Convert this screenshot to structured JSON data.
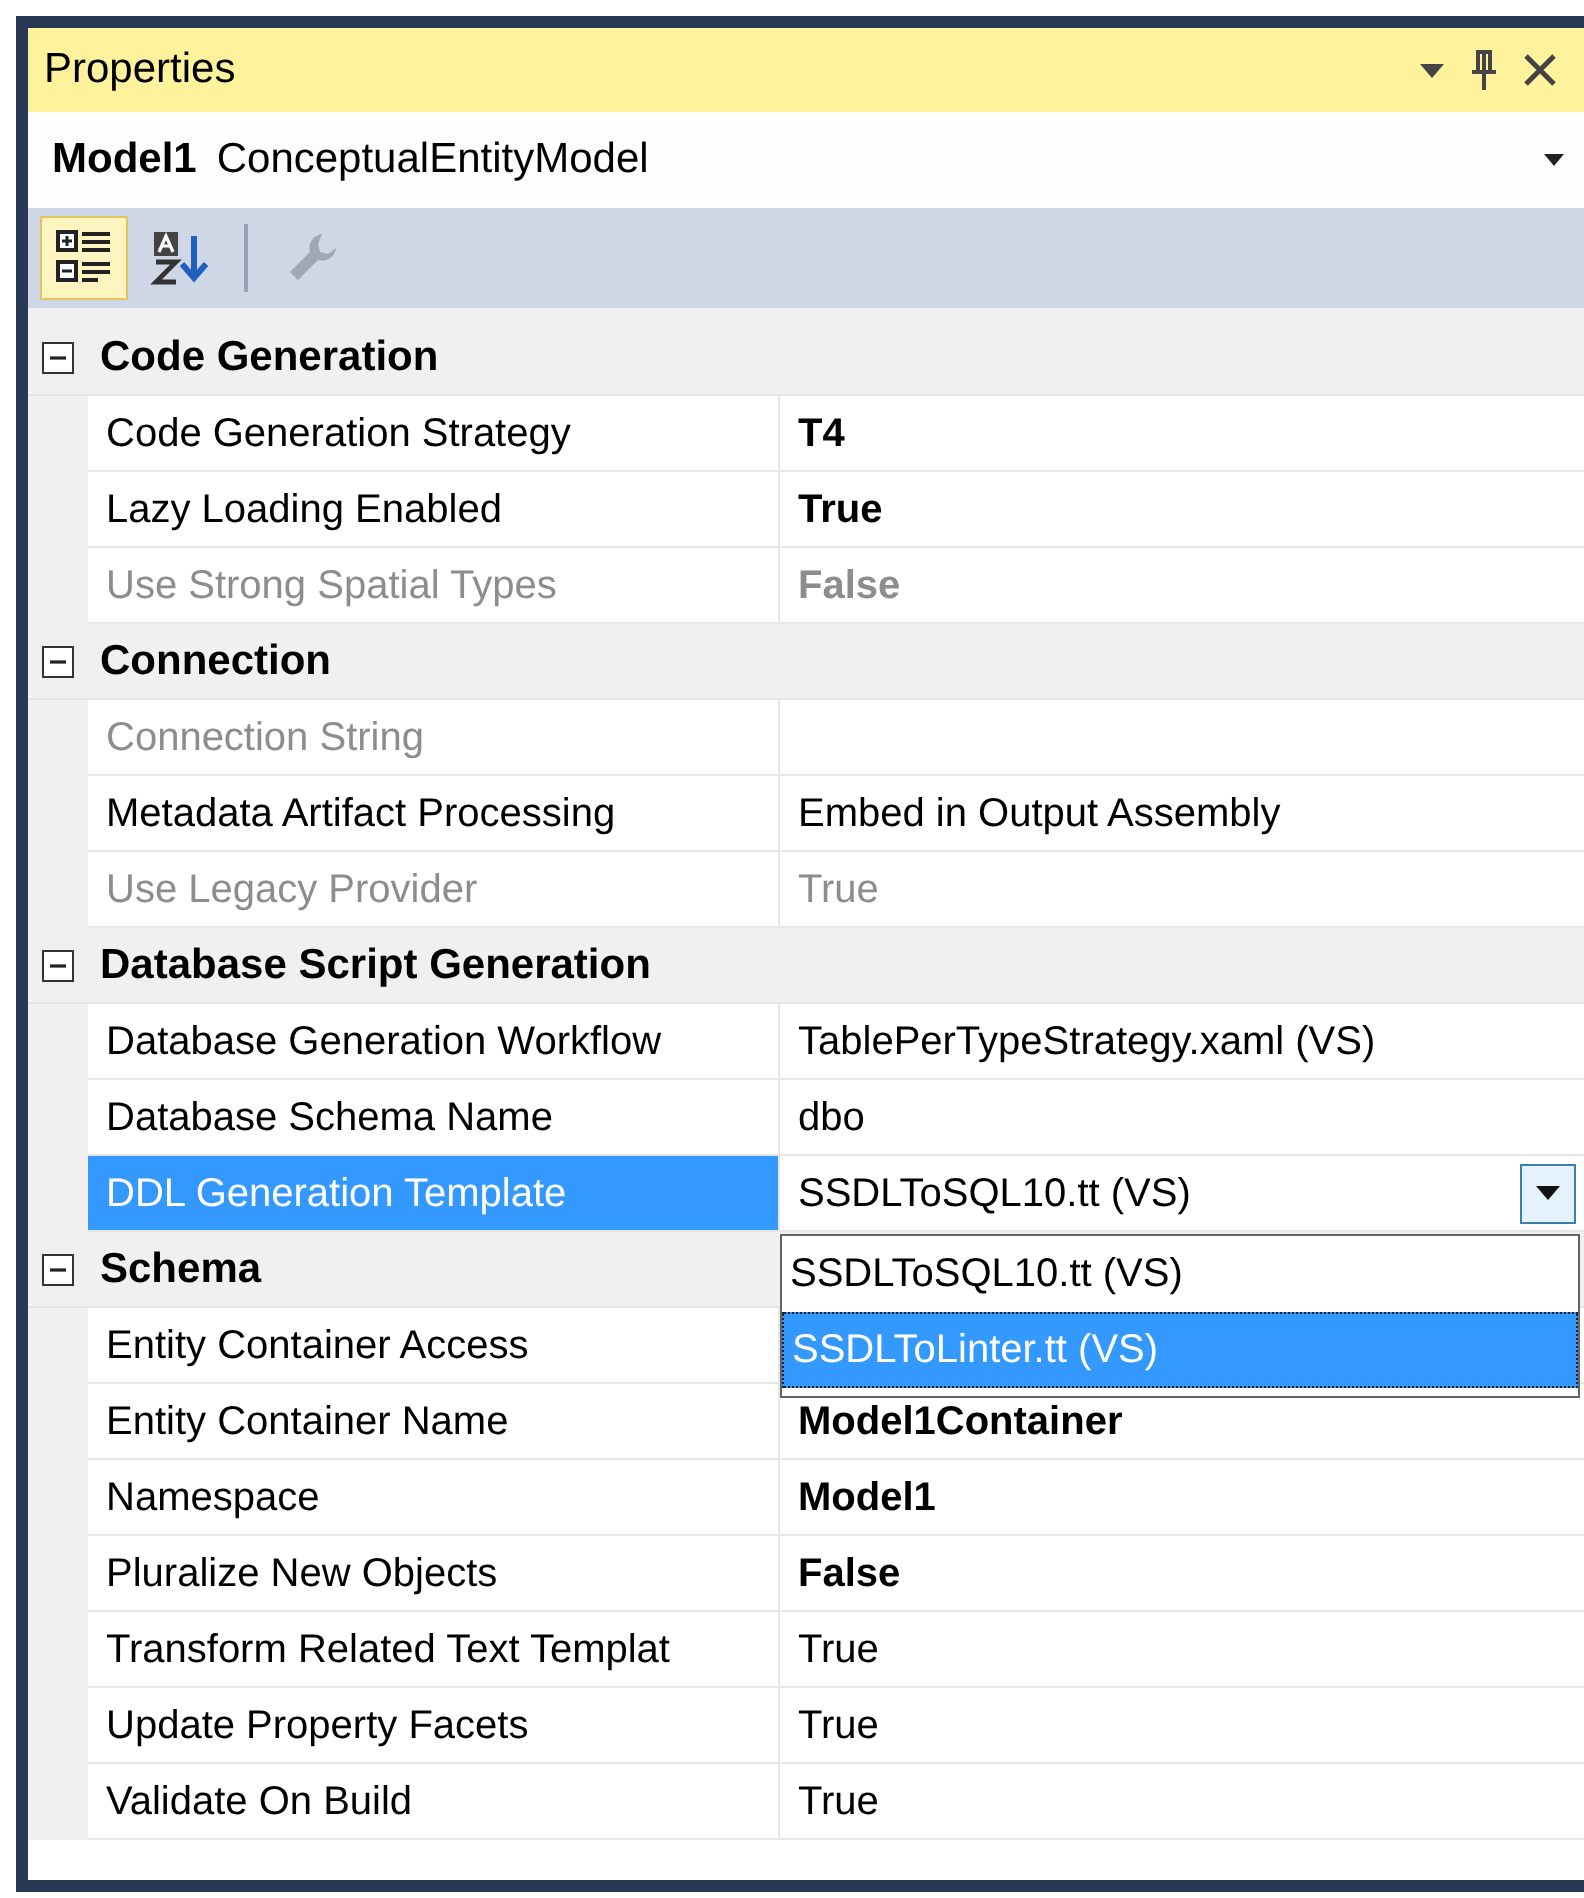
{
  "window": {
    "title": "Properties"
  },
  "object_selector": {
    "name": "Model1",
    "type": "ConceptualEntityModel"
  },
  "toolbar": [
    {
      "kind": "categorized",
      "selected": true
    },
    {
      "kind": "alphabetical",
      "selected": false
    },
    {
      "kind": "separator"
    },
    {
      "kind": "property-pages",
      "disabled": true
    }
  ],
  "categories": [
    {
      "title": "Code Generation",
      "expanded": true,
      "properties": [
        {
          "name": "Code Generation Strategy",
          "value": "T4",
          "bold": true,
          "disabled": false,
          "selected": false
        },
        {
          "name": "Lazy Loading Enabled",
          "value": "True",
          "bold": true,
          "disabled": false,
          "selected": false
        },
        {
          "name": "Use Strong Spatial Types",
          "value": "False",
          "bold": true,
          "disabled": true,
          "selected": false
        }
      ]
    },
    {
      "title": "Connection",
      "expanded": true,
      "properties": [
        {
          "name": "Connection String",
          "disabled": true,
          "selected": false
        },
        {
          "name": "Metadata Artifact Processing",
          "value": "Embed in Output Assembly",
          "bold": false,
          "disabled": false,
          "selected": false
        },
        {
          "name": "Use Legacy Provider",
          "value": "True",
          "bold": false,
          "disabled": true,
          "selected": false
        }
      ]
    },
    {
      "title": "Database Script Generation",
      "expanded": true,
      "properties": [
        {
          "name": "Database Generation Workflow",
          "value": "TablePerTypeStrategy.xaml (VS)",
          "bold": false,
          "disabled": false,
          "selected": false
        },
        {
          "name": "Database Schema Name",
          "value": "dbo",
          "bold": false,
          "disabled": false,
          "selected": false
        },
        {
          "name": "DDL Generation Template",
          "value": "SSDLToSQL10.tt (VS)",
          "bold": false,
          "disabled": false,
          "selected": true,
          "dropdown": {
            "options": [
              {
                "label": "SSDLToSQL10.tt (VS)",
                "selected": false
              },
              {
                "label": "SSDLToLinter.tt (VS)",
                "selected": true
              }
            ]
          }
        }
      ]
    },
    {
      "title": "Schema",
      "expanded": true,
      "properties": [
        {
          "name": "Entity Container Access",
          "disabled": false,
          "selected": false
        },
        {
          "name": "Entity Container Name",
          "value": "Model1Container",
          "bold": true,
          "disabled": false,
          "selected": false
        },
        {
          "name": "Namespace",
          "value": "Model1",
          "bold": true,
          "disabled": false,
          "selected": false
        },
        {
          "name": "Pluralize New Objects",
          "value": "False",
          "bold": true,
          "disabled": false,
          "selected": false
        },
        {
          "name": "Transform Related Text Templat",
          "value": "True",
          "bold": false,
          "disabled": false,
          "selected": false
        },
        {
          "name": "Update Property Facets",
          "value": "True",
          "bold": false,
          "disabled": false,
          "selected": false
        },
        {
          "name": "Validate On Build",
          "value": "True",
          "bold": false,
          "disabled": false,
          "selected": false
        }
      ]
    }
  ]
}
